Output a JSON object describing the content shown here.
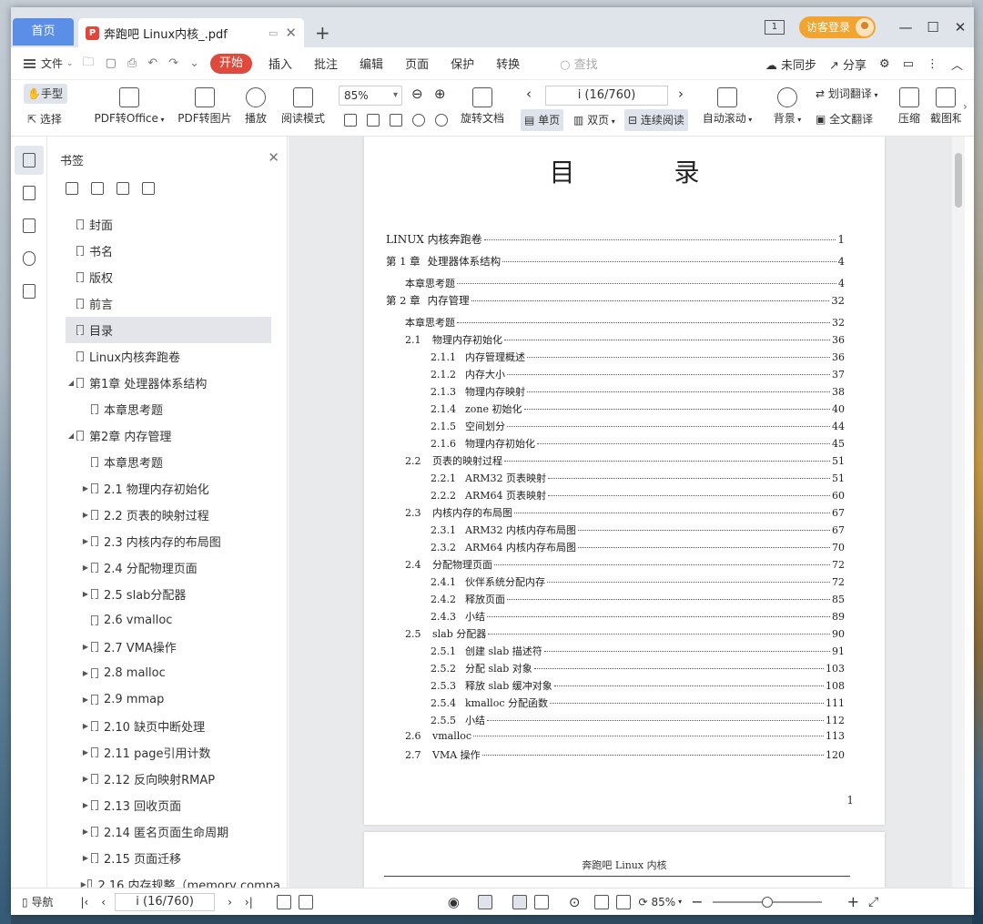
{
  "titlebar": {
    "home_tab": "首页",
    "doc_tab": "奔跑吧 Linux内核_.pdf",
    "login": "访客登录",
    "num_icon": "1"
  },
  "menu": {
    "file": "文件",
    "start": "开始",
    "items": [
      "插入",
      "批注",
      "编辑",
      "页面",
      "保护",
      "转换"
    ],
    "search_placeholder": "查找",
    "unsync": "未同步",
    "share": "分享"
  },
  "toolbar": {
    "hand": "手型",
    "select": "选择",
    "pdf_to_office": "PDF转Office",
    "pdf_to_image": "PDF转图片",
    "play": "播放",
    "read_mode": "阅读模式",
    "zoom": "85%",
    "rotate": "旋转文档",
    "page_indicator": "i (16/760)",
    "single": "单页",
    "double": "双页",
    "continuous": "连续阅读",
    "autoscroll": "自动滚动",
    "background": "背景",
    "word_translate": "划词翻译",
    "full_translate": "全文翻译",
    "compress": "压缩",
    "screenshot": "截图和"
  },
  "panel": {
    "title": "书签",
    "bookmarks": [
      {
        "label": "封面",
        "level": 0,
        "arrow": ""
      },
      {
        "label": "书名",
        "level": 0,
        "arrow": ""
      },
      {
        "label": "版权",
        "level": 0,
        "arrow": ""
      },
      {
        "label": "前言",
        "level": 0,
        "arrow": ""
      },
      {
        "label": "目录",
        "level": 0,
        "arrow": "",
        "active": true
      },
      {
        "label": "Linux内核奔跑卷",
        "level": 0,
        "arrow": ""
      },
      {
        "label": "第1章 处理器体系结构",
        "level": 0,
        "arrow": "◢"
      },
      {
        "label": "本章思考题",
        "level": 1,
        "arrow": ""
      },
      {
        "label": "第2章 内存管理",
        "level": 0,
        "arrow": "◢"
      },
      {
        "label": "本章思考题",
        "level": 1,
        "arrow": ""
      },
      {
        "label": "2.1 物理内存初始化",
        "level": 1,
        "arrow": "▶"
      },
      {
        "label": "2.2 页表的映射过程",
        "level": 1,
        "arrow": "▶"
      },
      {
        "label": "2.3 内核内存的布局图",
        "level": 1,
        "arrow": "▶"
      },
      {
        "label": "2.4 分配物理页面",
        "level": 1,
        "arrow": "▶"
      },
      {
        "label": "2.5 slab分配器",
        "level": 1,
        "arrow": "▶"
      },
      {
        "label": "2.6 vmalloc",
        "level": 1,
        "arrow": ""
      },
      {
        "label": "2.7 VMA操作",
        "level": 1,
        "arrow": "▶"
      },
      {
        "label": "2.8 malloc",
        "level": 1,
        "arrow": "▶"
      },
      {
        "label": "2.9 mmap",
        "level": 1,
        "arrow": "▶"
      },
      {
        "label": "2.10 缺页中断处理",
        "level": 1,
        "arrow": "▶"
      },
      {
        "label": "2.11 page引用计数",
        "level": 1,
        "arrow": "▶"
      },
      {
        "label": "2.12 反向映射RMAP",
        "level": 1,
        "arrow": "▶"
      },
      {
        "label": "2.13 回收页面",
        "level": 1,
        "arrow": "▶"
      },
      {
        "label": "2.14 匿名页面生命周期",
        "level": 1,
        "arrow": "▶"
      },
      {
        "label": "2.15 页面迁移",
        "level": 1,
        "arrow": "▶"
      },
      {
        "label": "2.16 内存规整（memory compa",
        "level": 1,
        "arrow": "▶"
      }
    ]
  },
  "document": {
    "toc_title": "目 录",
    "page_number": "1",
    "next_page_header": "奔跑吧 Linux 内核",
    "toc": [
      {
        "level": 0,
        "num": "",
        "title": "LINUX 内核奔跑卷",
        "page": "1"
      },
      {
        "level": 1,
        "num": "第 1 章",
        "title": "处理器体系结构",
        "page": "4"
      },
      {
        "level": 2,
        "num": "",
        "title": "本章思考题",
        "page": "4"
      },
      {
        "level": 1,
        "num": "第 2 章",
        "title": "内存管理",
        "page": "32"
      },
      {
        "level": 2,
        "num": "",
        "title": "本章思考题",
        "page": "32"
      },
      {
        "level": 2,
        "num": "2.1",
        "title": "物理内存初始化",
        "page": "36"
      },
      {
        "level": 3,
        "num": "2.1.1",
        "title": "内存管理概述",
        "page": "36"
      },
      {
        "level": 3,
        "num": "2.1.2",
        "title": "内存大小",
        "page": "37"
      },
      {
        "level": 3,
        "num": "2.1.3",
        "title": "物理内存映射",
        "page": "38"
      },
      {
        "level": 3,
        "num": "2.1.4",
        "title": "zone 初始化",
        "page": "40"
      },
      {
        "level": 3,
        "num": "2.1.5",
        "title": "空间划分",
        "page": "44"
      },
      {
        "level": 3,
        "num": "2.1.6",
        "title": "物理内存初始化",
        "page": "45"
      },
      {
        "level": 2,
        "num": "2.2",
        "title": "页表的映射过程",
        "page": "51"
      },
      {
        "level": 3,
        "num": "2.2.1",
        "title": "ARM32 页表映射",
        "page": "51"
      },
      {
        "level": 3,
        "num": "2.2.2",
        "title": "ARM64 页表映射",
        "page": "60"
      },
      {
        "level": 2,
        "num": "2.3",
        "title": "内核内存的布局图",
        "page": "67"
      },
      {
        "level": 3,
        "num": "2.3.1",
        "title": "ARM32 内核内存布局图",
        "page": "67"
      },
      {
        "level": 3,
        "num": "2.3.2",
        "title": "ARM64 内核内存布局图",
        "page": "70"
      },
      {
        "level": 2,
        "num": "2.4",
        "title": "分配物理页面",
        "page": "72"
      },
      {
        "level": 3,
        "num": "2.4.1",
        "title": "伙伴系统分配内存",
        "page": "72"
      },
      {
        "level": 3,
        "num": "2.4.2",
        "title": "释放页面",
        "page": "85"
      },
      {
        "level": 3,
        "num": "2.4.3",
        "title": "小结",
        "page": "89"
      },
      {
        "level": 2,
        "num": "2.5",
        "title": "slab 分配器",
        "page": "90"
      },
      {
        "level": 3,
        "num": "2.5.1",
        "title": "创建 slab 描述符",
        "page": "91"
      },
      {
        "level": 3,
        "num": "2.5.2",
        "title": "分配 slab 对象",
        "page": "103"
      },
      {
        "level": 3,
        "num": "2.5.3",
        "title": "释放 slab 缓冲对象",
        "page": "108"
      },
      {
        "level": 3,
        "num": "2.5.4",
        "title": "kmalloc 分配函数",
        "page": "111"
      },
      {
        "level": 3,
        "num": "2.5.5",
        "title": "小结",
        "page": "112"
      },
      {
        "level": 2,
        "num": "2.6",
        "title": "vmalloc",
        "page": "113"
      },
      {
        "level": 2,
        "num": "2.7",
        "title": "VMA 操作",
        "page": "120"
      }
    ]
  },
  "statusbar": {
    "nav": "导航",
    "page_indicator": "i (16/760)",
    "zoom": "85%",
    "zoom_level": 0.5
  }
}
